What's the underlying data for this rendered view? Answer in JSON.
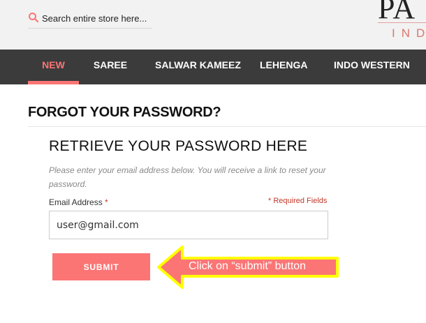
{
  "header": {
    "search": {
      "placeholder": "Search entire store here..."
    },
    "logo": {
      "top_text": "PA",
      "bottom_text": "IND"
    }
  },
  "nav": {
    "items": [
      {
        "label": "NEW",
        "active": true
      },
      {
        "label": "SAREE",
        "active": false
      },
      {
        "label": "SALWAR KAMEEZ",
        "active": false
      },
      {
        "label": "LEHENGA",
        "active": false
      },
      {
        "label": "INDO WESTERN",
        "active": false
      }
    ]
  },
  "page": {
    "title": "FORGOT YOUR PASSWORD?",
    "section_title": "RETRIEVE YOUR PASSWORD HERE",
    "hint": "Please enter your email address below. You will receive a link to reset your password.",
    "email_label": "Email Address",
    "required_star": "*",
    "required_fields": "* Required Fields",
    "email_value": "user@gmail.com",
    "submit_label": "SUBMIT"
  },
  "annotation": {
    "callout_text": "Click on “submit” button"
  },
  "colors": {
    "accent": "#fb7575",
    "nav_bg": "#3b3b3b",
    "topbar_bg": "#f2f2f2",
    "callout_fill": "#fb7575",
    "callout_border": "#ffff00",
    "required": "#c0392b"
  },
  "icons": {
    "search": "search-icon",
    "arrow": "left-arrow-callout"
  }
}
